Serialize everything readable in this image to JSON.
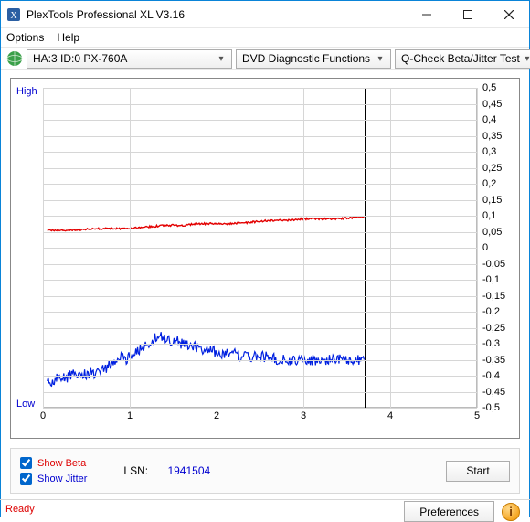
{
  "window": {
    "title": "PlexTools Professional XL V3.16"
  },
  "menu": {
    "options": "Options",
    "help": "Help"
  },
  "toolbar": {
    "device": "HA:3 ID:0  PX-760A",
    "function": "DVD Diagnostic Functions",
    "test": "Q-Check Beta/Jitter Test"
  },
  "chart_data": {
    "type": "line",
    "xlim": [
      0,
      5
    ],
    "ylim": [
      -0.5,
      0.5
    ],
    "xticks": [
      0,
      1,
      2,
      3,
      4,
      5
    ],
    "yticks": [
      0.5,
      0.45,
      0.4,
      0.35,
      0.3,
      0.25,
      0.2,
      0.15,
      0.1,
      0.05,
      0,
      -0.05,
      -0.1,
      -0.15,
      -0.2,
      -0.25,
      -0.3,
      -0.35,
      -0.4,
      -0.45,
      -0.5
    ],
    "ylabel_high": "High",
    "ylabel_low": "Low",
    "cursor_x": 3.7,
    "series": [
      {
        "name": "Beta",
        "color": "#e30000",
        "x": [
          0.05,
          0.2,
          0.4,
          0.6,
          0.8,
          1.0,
          1.2,
          1.4,
          1.6,
          1.8,
          2.0,
          2.2,
          2.4,
          2.6,
          2.8,
          3.0,
          3.2,
          3.4,
          3.6,
          3.7
        ],
        "y": [
          0.055,
          0.055,
          0.055,
          0.06,
          0.06,
          0.06,
          0.065,
          0.07,
          0.07,
          0.075,
          0.075,
          0.075,
          0.08,
          0.085,
          0.085,
          0.09,
          0.09,
          0.09,
          0.095,
          0.095
        ]
      },
      {
        "name": "Jitter",
        "color": "#0020e0",
        "x": [
          0.05,
          0.1,
          0.15,
          0.2,
          0.25,
          0.3,
          0.35,
          0.4,
          0.45,
          0.5,
          0.55,
          0.6,
          0.65,
          0.7,
          0.75,
          0.8,
          0.85,
          0.9,
          0.95,
          1.0,
          1.05,
          1.1,
          1.15,
          1.2,
          1.25,
          1.3,
          1.35,
          1.4,
          1.45,
          1.5,
          1.55,
          1.6,
          1.65,
          1.7,
          1.75,
          1.8,
          1.85,
          1.9,
          1.95,
          2.0,
          2.1,
          2.2,
          2.3,
          2.4,
          2.5,
          2.6,
          2.7,
          2.8,
          2.9,
          3.0,
          3.1,
          3.2,
          3.3,
          3.4,
          3.5,
          3.6,
          3.7
        ],
        "y": [
          -0.4,
          -0.42,
          -0.41,
          -0.4,
          -0.41,
          -0.4,
          -0.39,
          -0.4,
          -0.39,
          -0.4,
          -0.39,
          -0.4,
          -0.39,
          -0.38,
          -0.37,
          -0.36,
          -0.35,
          -0.34,
          -0.35,
          -0.34,
          -0.33,
          -0.32,
          -0.31,
          -0.3,
          -0.29,
          -0.28,
          -0.27,
          -0.28,
          -0.29,
          -0.3,
          -0.29,
          -0.3,
          -0.3,
          -0.31,
          -0.31,
          -0.31,
          -0.32,
          -0.32,
          -0.32,
          -0.33,
          -0.33,
          -0.33,
          -0.34,
          -0.34,
          -0.34,
          -0.34,
          -0.35,
          -0.35,
          -0.35,
          -0.35,
          -0.35,
          -0.35,
          -0.35,
          -0.35,
          -0.35,
          -0.35,
          -0.35
        ]
      }
    ]
  },
  "controls": {
    "show_beta": "Show Beta",
    "show_jitter": "Show Jitter",
    "lsn_label": "LSN:",
    "lsn_value": "1941504",
    "start": "Start",
    "prefs": "Preferences"
  },
  "status": {
    "text": "Ready"
  }
}
